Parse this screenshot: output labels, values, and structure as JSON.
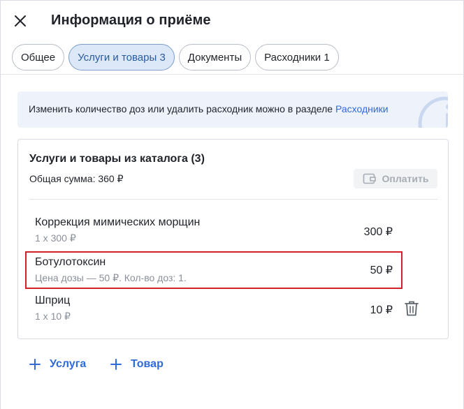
{
  "header": {
    "title": "Информация о приёме"
  },
  "tabs": [
    {
      "label": "Общее",
      "active": false
    },
    {
      "label": "Услуги и товары 3",
      "active": true
    },
    {
      "label": "Документы",
      "active": false
    },
    {
      "label": "Расходники 1",
      "active": false
    }
  ],
  "info": {
    "text": "Изменить количество доз или удалить расходник можно в разделе ",
    "link": "Расходники"
  },
  "catalog": {
    "title": "Услуги и товары из каталога (3)",
    "total": "Общая сумма: 360 ₽",
    "pay_label": "Оплатить",
    "items": [
      {
        "name": "Коррекция мимических морщин",
        "sub": "1 x 300 ₽",
        "price": "300 ₽"
      },
      {
        "name": "Ботулотоксин",
        "sub": "Цена дозы — 50 ₽. Кол-во доз: 1.",
        "price": "50 ₽"
      },
      {
        "name": "Шприц",
        "sub": "1 x 10 ₽",
        "price": "10 ₽"
      }
    ]
  },
  "actions": {
    "add_service": "Услуга",
    "add_product": "Товар"
  },
  "colors": {
    "accent": "#2f6ad8",
    "highlight": "#d31f26",
    "tab_active_bg": "#dce8f8"
  }
}
